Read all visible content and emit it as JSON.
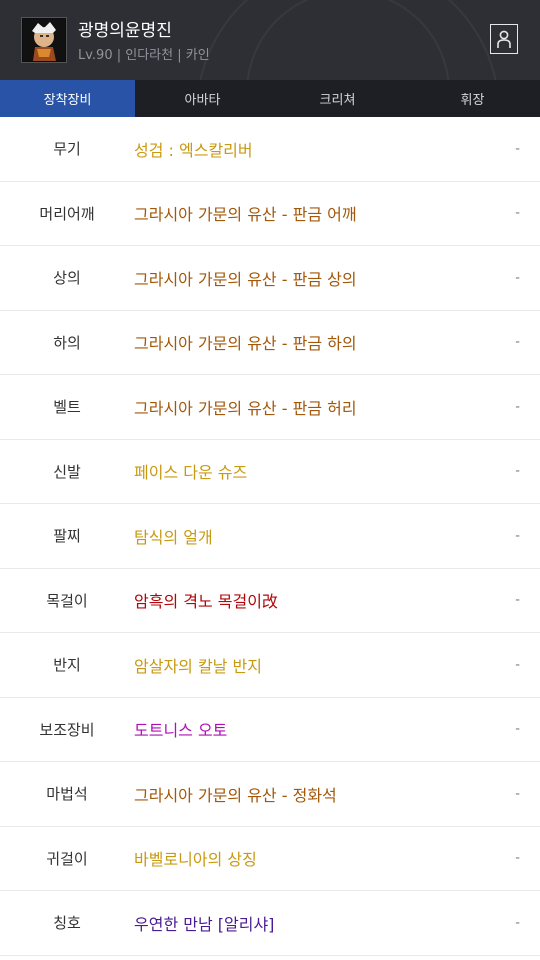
{
  "header": {
    "char_name": "광명의윤명진",
    "char_info": "Lv.90 | 인다라천 | 카인"
  },
  "tabs": [
    {
      "label": "장착장비",
      "active": true
    },
    {
      "label": "아바타",
      "active": false
    },
    {
      "label": "크리쳐",
      "active": false
    },
    {
      "label": "휘장",
      "active": false
    }
  ],
  "colors": {
    "epic": "#c89a12",
    "set": "#a3570a",
    "legendary": "#b0070b",
    "unique": "#b10eb6",
    "title": "#4a1c93"
  },
  "equipment": [
    {
      "slot": "무기",
      "item": "성검 : 엑스칼리버",
      "grade": "epic",
      "value": "-"
    },
    {
      "slot": "머리어깨",
      "item": "그라시아 가문의 유산 - 판금 어깨",
      "grade": "set",
      "value": "-"
    },
    {
      "slot": "상의",
      "item": "그라시아 가문의 유산 - 판금 상의",
      "grade": "set",
      "value": "-"
    },
    {
      "slot": "하의",
      "item": "그라시아 가문의 유산 - 판금 하의",
      "grade": "set",
      "value": "-"
    },
    {
      "slot": "벨트",
      "item": "그라시아 가문의 유산 - 판금 허리",
      "grade": "set",
      "value": "-"
    },
    {
      "slot": "신발",
      "item": "페이스 다운 슈즈",
      "grade": "epic",
      "value": "-"
    },
    {
      "slot": "팔찌",
      "item": "탐식의 얼개",
      "grade": "epic",
      "value": "-"
    },
    {
      "slot": "목걸이",
      "item": "암흑의 격노 목걸이改",
      "grade": "legendary",
      "value": "-"
    },
    {
      "slot": "반지",
      "item": "암살자의 칼날 반지",
      "grade": "epic",
      "value": "-"
    },
    {
      "slot": "보조장비",
      "item": "도트니스 오토",
      "grade": "unique",
      "value": "-"
    },
    {
      "slot": "마법석",
      "item": "그라시아 가문의 유산 - 정화석",
      "grade": "set",
      "value": "-"
    },
    {
      "slot": "귀걸이",
      "item": "바벨로니아의 상징",
      "grade": "epic",
      "value": "-"
    },
    {
      "slot": "칭호",
      "item": "우연한 만남 [알리샤]",
      "grade": "title",
      "value": "-"
    }
  ]
}
